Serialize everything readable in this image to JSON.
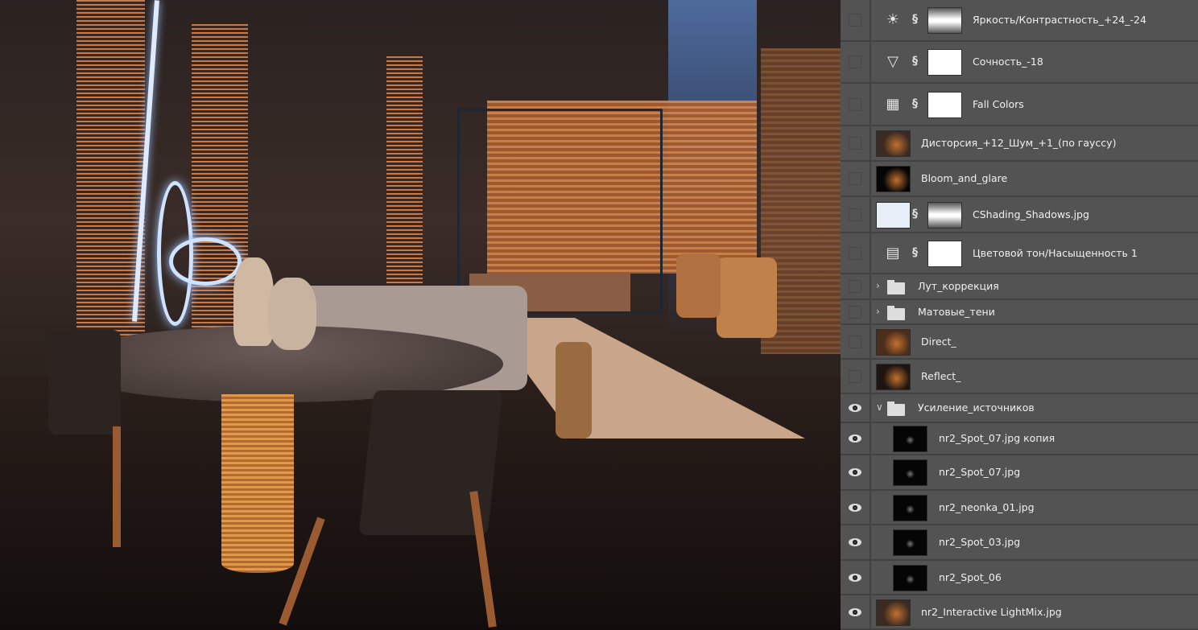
{
  "layers": [
    {
      "name": "Яркость/Контрастность_+24_-24",
      "kind": "adjustment",
      "icon": "brightness-contrast-icon",
      "glyph": "☀",
      "mask": "gradient",
      "visible": false
    },
    {
      "name": "Сочность_-18",
      "kind": "adjustment",
      "icon": "vibrance-icon",
      "glyph": "▽",
      "mask": "white",
      "visible": false
    },
    {
      "name": "Fall Colors",
      "kind": "adjustment",
      "icon": "color-lookup-icon",
      "glyph": "▦",
      "mask": "white",
      "visible": false
    },
    {
      "name": "Дисторсия_+12_Шум_+1_(по гауссу)",
      "kind": "image",
      "thumb": "#3b2a22",
      "visible": false
    },
    {
      "name": "Bloom_and_glare",
      "kind": "image",
      "thumb": "#050505",
      "visible": false
    },
    {
      "name": "CShading_Shadows.jpg",
      "kind": "image-mask",
      "thumb": "#e8eef8",
      "mask": "gradient",
      "visible": false
    },
    {
      "name": "Цветовой тон/Насыщенность 1",
      "kind": "adjustment",
      "icon": "hue-saturation-icon",
      "glyph": "▤",
      "mask": "white",
      "visible": false
    },
    {
      "name": "Лут_коррекция",
      "kind": "folder",
      "expanded": false,
      "visible": false
    },
    {
      "name": "Матовые_тени",
      "kind": "folder",
      "expanded": false,
      "visible": false
    },
    {
      "name": "Direct_",
      "kind": "image",
      "thumb": "#4a2d1a",
      "visible": false
    },
    {
      "name": "Reflect_",
      "kind": "image",
      "thumb": "#1e1410",
      "visible": false
    },
    {
      "name": "Усиление_источников",
      "kind": "folder",
      "expanded": true,
      "visible": true
    },
    {
      "name": "nr2_Spot_07.jpg копия",
      "kind": "child",
      "thumb": "#050505",
      "visible": true
    },
    {
      "name": "nr2_Spot_07.jpg",
      "kind": "child",
      "thumb": "#050505",
      "visible": true
    },
    {
      "name": "nr2_neonka_01.jpg",
      "kind": "child",
      "thumb": "#050505",
      "visible": true
    },
    {
      "name": "nr2_Spot_03.jpg",
      "kind": "child",
      "thumb": "#050505",
      "visible": true
    },
    {
      "name": "nr2_Spot_06",
      "kind": "child",
      "thumb": "#050505",
      "visible": true
    },
    {
      "name": "nr2_Interactive LightMix.jpg",
      "kind": "image",
      "thumb": "#3b2a22",
      "visible": true
    }
  ]
}
